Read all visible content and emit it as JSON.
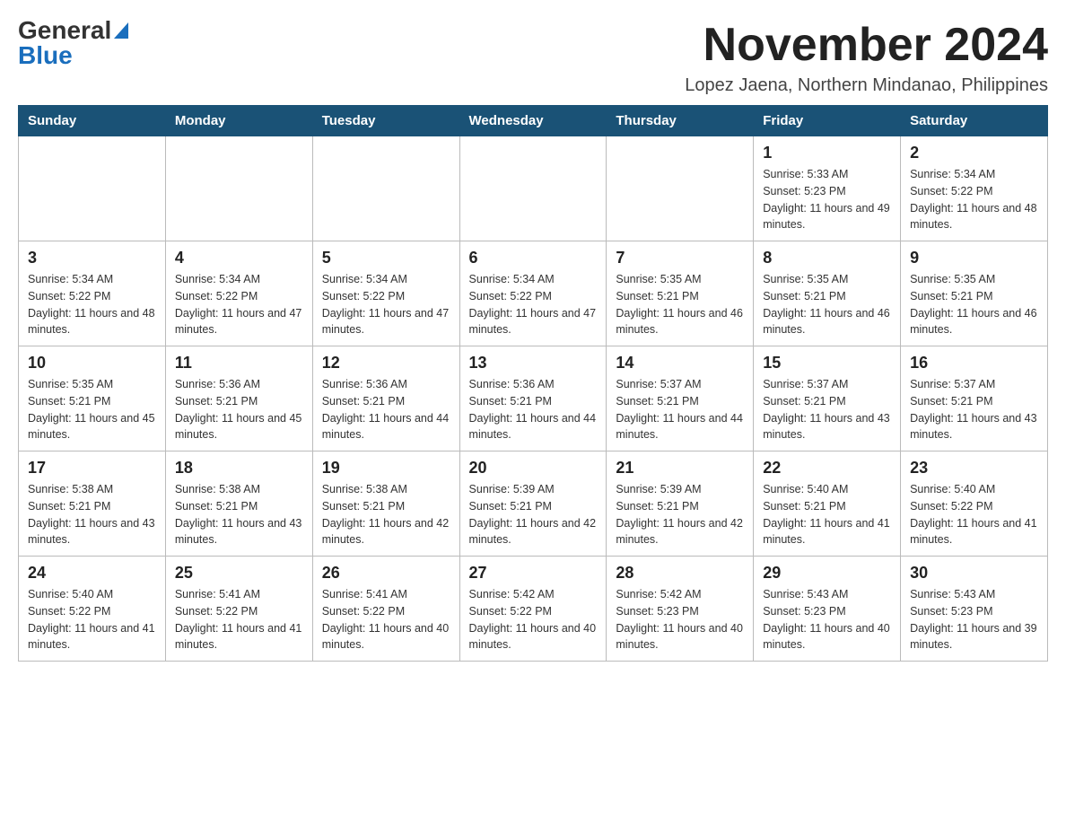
{
  "header": {
    "logo_general": "General",
    "logo_blue": "Blue",
    "month_title": "November 2024",
    "location": "Lopez Jaena, Northern Mindanao, Philippines"
  },
  "weekdays": [
    "Sunday",
    "Monday",
    "Tuesday",
    "Wednesday",
    "Thursday",
    "Friday",
    "Saturday"
  ],
  "weeks": [
    [
      {
        "day": "",
        "info": ""
      },
      {
        "day": "",
        "info": ""
      },
      {
        "day": "",
        "info": ""
      },
      {
        "day": "",
        "info": ""
      },
      {
        "day": "",
        "info": ""
      },
      {
        "day": "1",
        "info": "Sunrise: 5:33 AM\nSunset: 5:23 PM\nDaylight: 11 hours and 49 minutes."
      },
      {
        "day": "2",
        "info": "Sunrise: 5:34 AM\nSunset: 5:22 PM\nDaylight: 11 hours and 48 minutes."
      }
    ],
    [
      {
        "day": "3",
        "info": "Sunrise: 5:34 AM\nSunset: 5:22 PM\nDaylight: 11 hours and 48 minutes."
      },
      {
        "day": "4",
        "info": "Sunrise: 5:34 AM\nSunset: 5:22 PM\nDaylight: 11 hours and 47 minutes."
      },
      {
        "day": "5",
        "info": "Sunrise: 5:34 AM\nSunset: 5:22 PM\nDaylight: 11 hours and 47 minutes."
      },
      {
        "day": "6",
        "info": "Sunrise: 5:34 AM\nSunset: 5:22 PM\nDaylight: 11 hours and 47 minutes."
      },
      {
        "day": "7",
        "info": "Sunrise: 5:35 AM\nSunset: 5:21 PM\nDaylight: 11 hours and 46 minutes."
      },
      {
        "day": "8",
        "info": "Sunrise: 5:35 AM\nSunset: 5:21 PM\nDaylight: 11 hours and 46 minutes."
      },
      {
        "day": "9",
        "info": "Sunrise: 5:35 AM\nSunset: 5:21 PM\nDaylight: 11 hours and 46 minutes."
      }
    ],
    [
      {
        "day": "10",
        "info": "Sunrise: 5:35 AM\nSunset: 5:21 PM\nDaylight: 11 hours and 45 minutes."
      },
      {
        "day": "11",
        "info": "Sunrise: 5:36 AM\nSunset: 5:21 PM\nDaylight: 11 hours and 45 minutes."
      },
      {
        "day": "12",
        "info": "Sunrise: 5:36 AM\nSunset: 5:21 PM\nDaylight: 11 hours and 44 minutes."
      },
      {
        "day": "13",
        "info": "Sunrise: 5:36 AM\nSunset: 5:21 PM\nDaylight: 11 hours and 44 minutes."
      },
      {
        "day": "14",
        "info": "Sunrise: 5:37 AM\nSunset: 5:21 PM\nDaylight: 11 hours and 44 minutes."
      },
      {
        "day": "15",
        "info": "Sunrise: 5:37 AM\nSunset: 5:21 PM\nDaylight: 11 hours and 43 minutes."
      },
      {
        "day": "16",
        "info": "Sunrise: 5:37 AM\nSunset: 5:21 PM\nDaylight: 11 hours and 43 minutes."
      }
    ],
    [
      {
        "day": "17",
        "info": "Sunrise: 5:38 AM\nSunset: 5:21 PM\nDaylight: 11 hours and 43 minutes."
      },
      {
        "day": "18",
        "info": "Sunrise: 5:38 AM\nSunset: 5:21 PM\nDaylight: 11 hours and 43 minutes."
      },
      {
        "day": "19",
        "info": "Sunrise: 5:38 AM\nSunset: 5:21 PM\nDaylight: 11 hours and 42 minutes."
      },
      {
        "day": "20",
        "info": "Sunrise: 5:39 AM\nSunset: 5:21 PM\nDaylight: 11 hours and 42 minutes."
      },
      {
        "day": "21",
        "info": "Sunrise: 5:39 AM\nSunset: 5:21 PM\nDaylight: 11 hours and 42 minutes."
      },
      {
        "day": "22",
        "info": "Sunrise: 5:40 AM\nSunset: 5:21 PM\nDaylight: 11 hours and 41 minutes."
      },
      {
        "day": "23",
        "info": "Sunrise: 5:40 AM\nSunset: 5:22 PM\nDaylight: 11 hours and 41 minutes."
      }
    ],
    [
      {
        "day": "24",
        "info": "Sunrise: 5:40 AM\nSunset: 5:22 PM\nDaylight: 11 hours and 41 minutes."
      },
      {
        "day": "25",
        "info": "Sunrise: 5:41 AM\nSunset: 5:22 PM\nDaylight: 11 hours and 41 minutes."
      },
      {
        "day": "26",
        "info": "Sunrise: 5:41 AM\nSunset: 5:22 PM\nDaylight: 11 hours and 40 minutes."
      },
      {
        "day": "27",
        "info": "Sunrise: 5:42 AM\nSunset: 5:22 PM\nDaylight: 11 hours and 40 minutes."
      },
      {
        "day": "28",
        "info": "Sunrise: 5:42 AM\nSunset: 5:23 PM\nDaylight: 11 hours and 40 minutes."
      },
      {
        "day": "29",
        "info": "Sunrise: 5:43 AM\nSunset: 5:23 PM\nDaylight: 11 hours and 40 minutes."
      },
      {
        "day": "30",
        "info": "Sunrise: 5:43 AM\nSunset: 5:23 PM\nDaylight: 11 hours and 39 minutes."
      }
    ]
  ]
}
